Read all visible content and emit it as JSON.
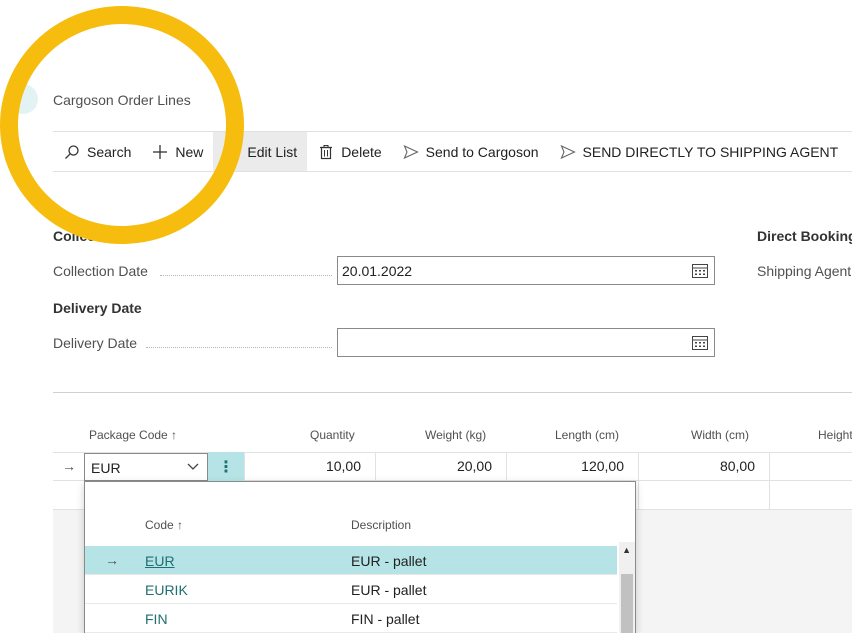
{
  "page": {
    "title": "Cargoson Order Lines"
  },
  "toolbar": {
    "search": "Search",
    "new": "New",
    "edit_list": "Edit List",
    "delete": "Delete",
    "send_to_cargoson": "Send to Cargoson",
    "send_directly": "SEND DIRECTLY TO SHIPPING AGENT"
  },
  "collection": {
    "group_title": "Collection",
    "date_label": "Collection Date",
    "date_value": "20.01.2022"
  },
  "delivery": {
    "group_title": "Delivery Date",
    "date_label": "Delivery Date",
    "date_value": ""
  },
  "direct_booking": {
    "group_title": "Direct Booking",
    "agent_label": "Shipping Agent"
  },
  "grid": {
    "columns": [
      "Package Code ↑",
      "Quantity",
      "Weight (kg)",
      "Length (cm)",
      "Width (cm)",
      "Height"
    ],
    "rows": [
      {
        "package_code": "EUR",
        "quantity": "10,00",
        "weight": "20,00",
        "length": "120,00",
        "width": "80,00"
      }
    ]
  },
  "lookup": {
    "columns": [
      "Code ↑",
      "Description"
    ],
    "rows": [
      {
        "code": "EUR",
        "description": "EUR - pallet"
      },
      {
        "code": "EURIK",
        "description": "EUR - pallet"
      },
      {
        "code": "FIN",
        "description": "FIN - pallet"
      }
    ]
  },
  "colors": {
    "accent": "#b6e4e6",
    "link": "#1f6f73",
    "highlight": "#f6bd0f"
  }
}
